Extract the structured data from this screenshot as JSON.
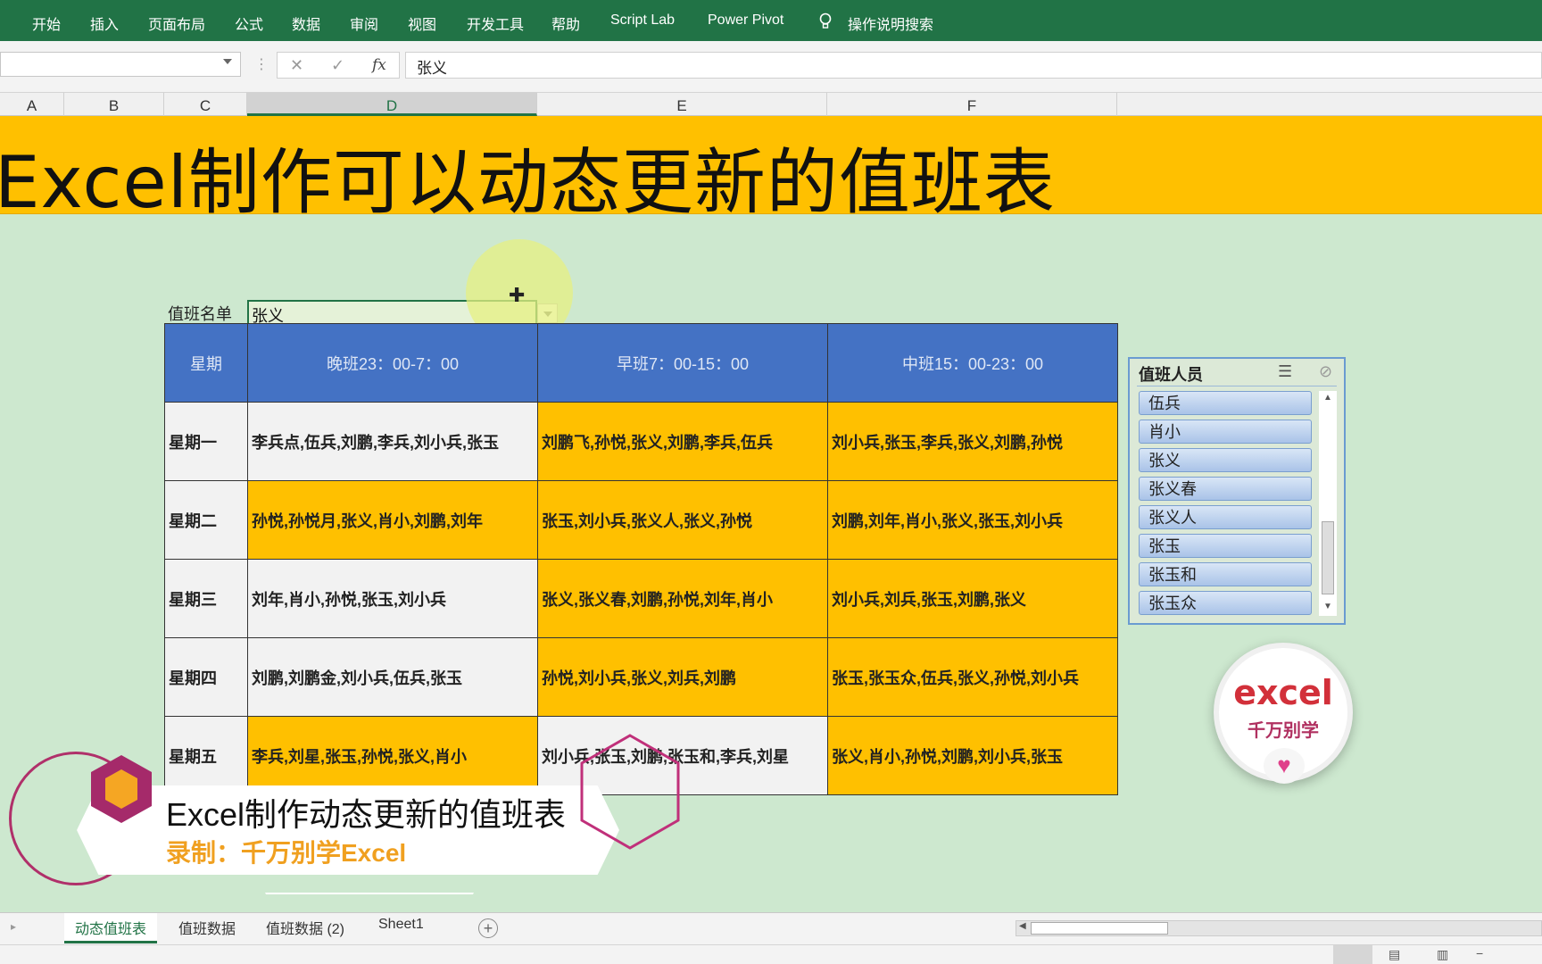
{
  "ribbon": {
    "tabs": [
      "开始",
      "插入",
      "页面布局",
      "公式",
      "数据",
      "审阅",
      "视图",
      "开发工具",
      "帮助",
      "Script Lab",
      "Power Pivot"
    ],
    "search_label": "操作说明搜索"
  },
  "formula_bar": {
    "name_box": "",
    "formula_value": "张义"
  },
  "columns": [
    "A",
    "B",
    "C",
    "D",
    "E",
    "F"
  ],
  "banner": {
    "title": "Excel制作可以动态更新的值班表"
  },
  "duty": {
    "label": "值班名单",
    "value": "张义"
  },
  "table": {
    "headers": [
      "星期",
      "晚班23：00-7：00",
      "早班7：00-15：00",
      "中班15：00-23：00"
    ],
    "rows": [
      {
        "day": "星期一",
        "night": "李兵点,伍兵,刘鹏,李兵,刘小兵,张玉",
        "morning": "刘鹏飞,孙悦,张义,刘鹏,李兵,伍兵",
        "mid": "刘小兵,张玉,李兵,张义,刘鹏,孙悦"
      },
      {
        "day": "星期二",
        "night": "孙悦,孙悦月,张义,肖小,刘鹏,刘年",
        "morning": "张玉,刘小兵,张义人,张义,孙悦",
        "mid": "刘鹏,刘年,肖小,张义,张玉,刘小兵"
      },
      {
        "day": "星期三",
        "night": "刘年,肖小,孙悦,张玉,刘小兵",
        "morning": "张义,张义春,刘鹏,孙悦,刘年,肖小",
        "mid": "刘小兵,刘兵,张玉,刘鹏,张义"
      },
      {
        "day": "星期四",
        "night": "刘鹏,刘鹏金,刘小兵,伍兵,张玉",
        "morning": "孙悦,刘小兵,张义,刘兵,刘鹏",
        "mid": "张玉,张玉众,伍兵,张义,孙悦,刘小兵"
      },
      {
        "day": "星期五",
        "night": "李兵,刘星,张玉,孙悦,张义,肖小",
        "morning": "刘小兵,张玉,刘鹏,张玉和,李兵,刘星",
        "mid": "张义,肖小,孙悦,刘鹏,刘小兵,张玉"
      }
    ],
    "highlight": [
      [
        "w",
        "y",
        "y"
      ],
      [
        "y",
        "y",
        "y"
      ],
      [
        "w",
        "y",
        "y"
      ],
      [
        "w",
        "y",
        "y"
      ],
      [
        "y",
        "w",
        "y"
      ]
    ]
  },
  "slicer": {
    "title": "值班人员",
    "items": [
      "伍兵",
      "肖小",
      "张义",
      "张义春",
      "张义人",
      "张玉",
      "张玉和",
      "张玉众"
    ]
  },
  "logo": {
    "line1": "excel",
    "line2": "千万别学"
  },
  "overlay": {
    "title": "Excel制作动态更新的值班表",
    "subtitle": "录制：千万别学Excel"
  },
  "sheets": [
    "动态值班表",
    "值班数据",
    "值班数据 (2)",
    "Sheet1"
  ],
  "colors": {
    "ribbon": "#217346",
    "banner": "#ffc000",
    "header": "#4472c4",
    "background": "#cde8cf"
  }
}
